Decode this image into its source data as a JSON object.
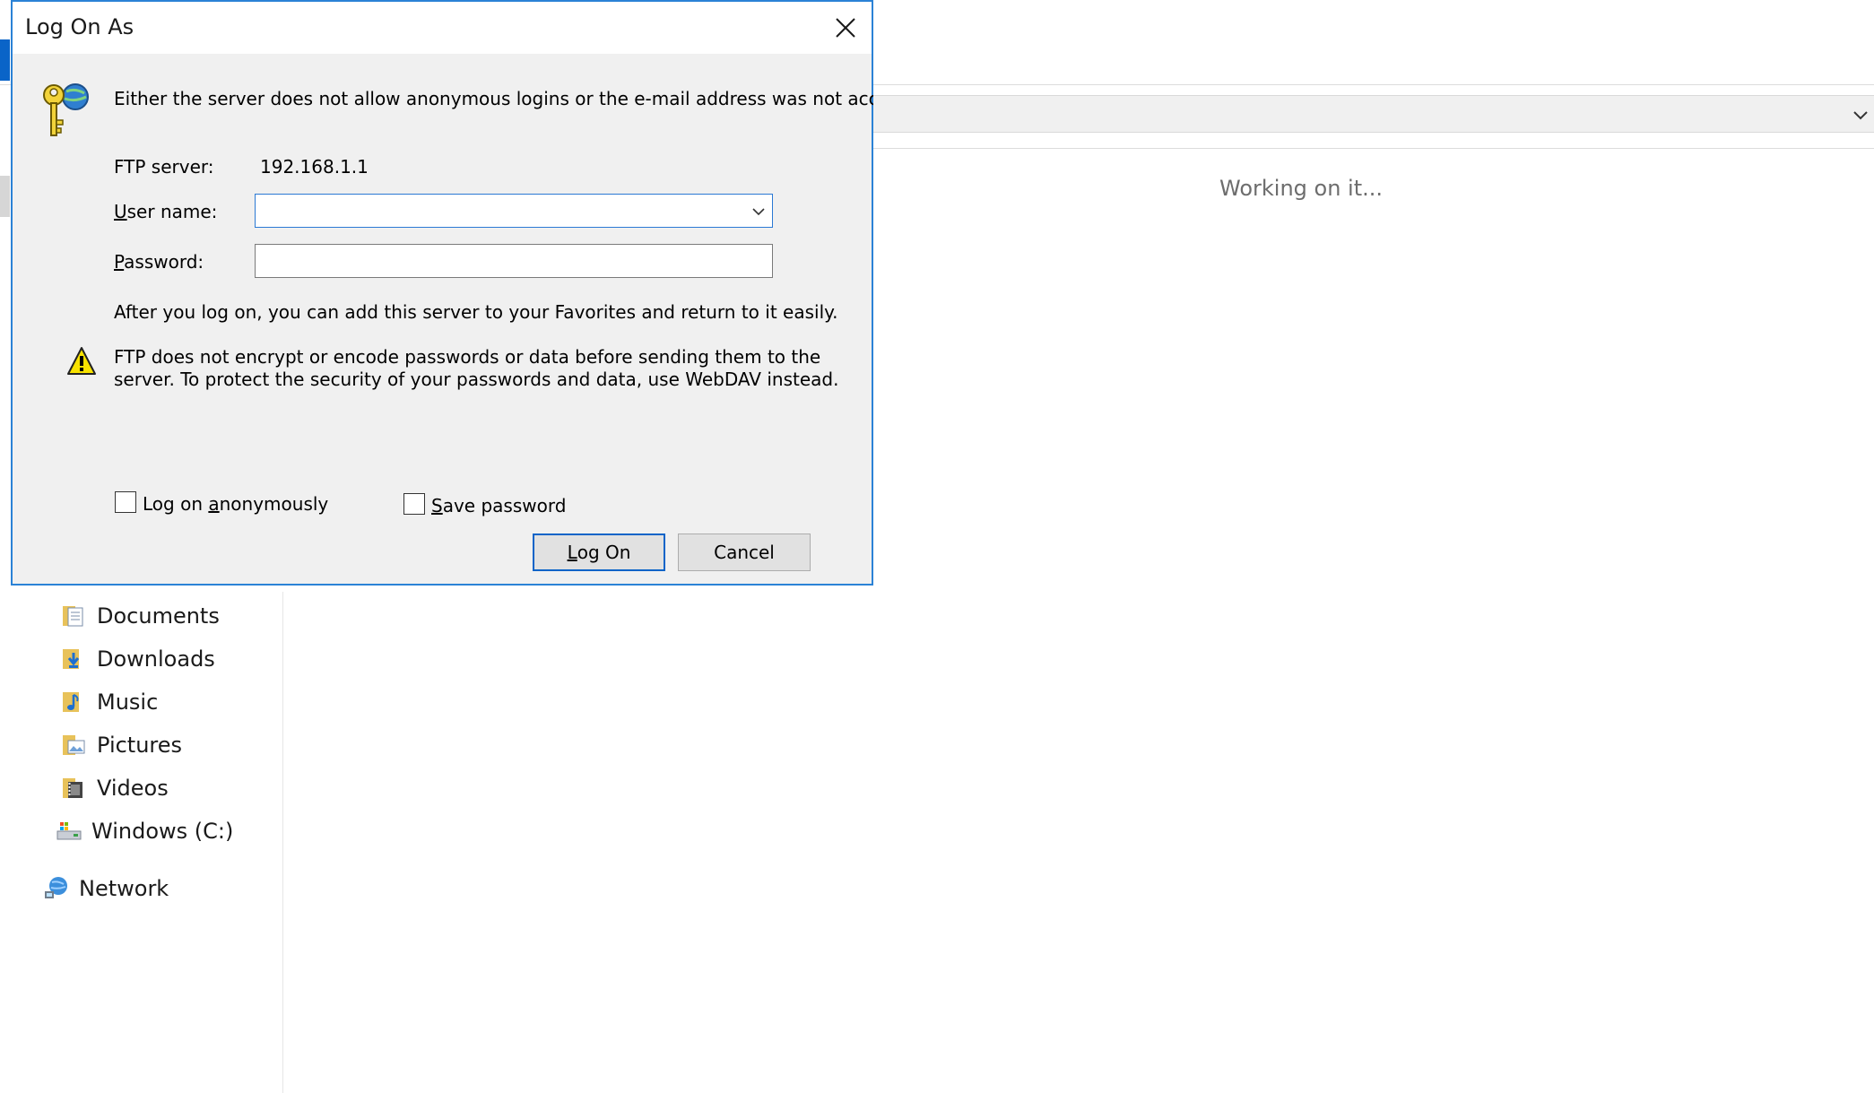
{
  "dialog": {
    "title": "Log On As",
    "message": "Either the server does not allow anonymous logins or the e-mail address was not accepted.",
    "ftp_server_label": "FTP server:",
    "ftp_server_value": "192.168.1.1",
    "username_label_pre": "",
    "username_label_key": "U",
    "username_label_post": "ser name:",
    "username_value": "",
    "password_label_key": "P",
    "password_label_post": "assword:",
    "password_value": "",
    "hint": "After you log on, you can add this server to your Favorites and return to it easily.",
    "warning_line1": "FTP does not encrypt or encode passwords or data before sending them to the",
    "warning_line2": "server.  To protect the security of your passwords and data, use WebDAV instead.",
    "anon_label_pre": "Log on ",
    "anon_label_key": "a",
    "anon_label_post": "nonymously",
    "anon_checked": false,
    "save_label_key": "S",
    "save_label_post": "ave password",
    "save_checked": false,
    "logon_key": "L",
    "logon_post": "og On",
    "cancel_label": "Cancel"
  },
  "explorer": {
    "status": "Working on it...",
    "nav": [
      {
        "label": "Documents",
        "icon": "documents-folder-icon"
      },
      {
        "label": "Downloads",
        "icon": "downloads-folder-icon"
      },
      {
        "label": "Music",
        "icon": "music-folder-icon"
      },
      {
        "label": "Pictures",
        "icon": "pictures-folder-icon"
      },
      {
        "label": "Videos",
        "icon": "videos-folder-icon"
      },
      {
        "label": "Windows (C:)",
        "icon": "drive-icon"
      },
      {
        "label": "Network",
        "icon": "network-icon"
      }
    ]
  },
  "colors": {
    "dialog_border": "#2b82d6",
    "dialog_bg": "#f0f0f0",
    "default_button_border": "#0a64c8"
  }
}
